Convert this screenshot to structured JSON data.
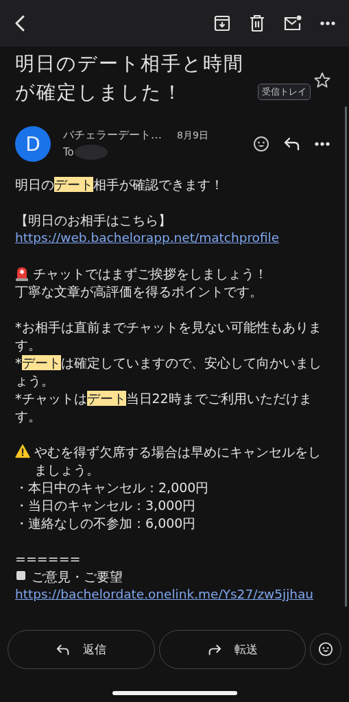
{
  "toolbar": {
    "actions": [
      {
        "kind": "archive"
      },
      {
        "kind": "delete"
      },
      {
        "kind": "unread"
      },
      {
        "kind": "more"
      }
    ]
  },
  "subject": {
    "title": "明日のデート相手と時間が確定しました！",
    "label": "受信トレイ",
    "starred": false
  },
  "message": {
    "avatar": "D",
    "sender": "バチェラーデート…",
    "date": "8月9日",
    "to": "To"
  },
  "body": [
    {
      "lines": [
        {
          "kind": "text",
          "segments": [
            {
              "text": "明日の",
              "highlighted": false
            },
            {
              "text": "デート",
              "highlighted": true
            },
            {
              "text": "相手が確認できます！",
              "highlighted": false
            }
          ]
        }
      ]
    },
    {
      "lines": [
        {
          "kind": "text",
          "segments": [
            {
              "text": "【明日のお相手はこちら】",
              "highlighted": false
            }
          ]
        },
        {
          "kind": "link",
          "segments": [
            {
              "text": "https://web.bachelorapp.net/matchprofile",
              "highlighted": false
            }
          ]
        }
      ]
    },
    {
      "lines": [
        {
          "kind": "siren",
          "segments": [
            {
              "text": "チャットではまずご挨拶をしましょう！",
              "highlighted": false
            }
          ]
        },
        {
          "kind": "text",
          "segments": [
            {
              "text": "丁寧な文章が高評価を得るポイントです。",
              "highlighted": false
            }
          ]
        }
      ]
    },
    {
      "lines": [
        {
          "kind": "text",
          "segments": [
            {
              "text": "*お相手は直前までチャットを見ない可能性もあります。",
              "highlighted": false
            }
          ]
        },
        {
          "kind": "text",
          "segments": [
            {
              "text": "*",
              "highlighted": false
            },
            {
              "text": "デート",
              "highlighted": true
            },
            {
              "text": "は確定していますので、安心して向かいましょう。",
              "highlighted": false
            }
          ]
        },
        {
          "kind": "text",
          "segments": [
            {
              "text": "*チャットは",
              "highlighted": false
            },
            {
              "text": "デート",
              "highlighted": true
            },
            {
              "text": "当日22時までご利用いただけます。",
              "highlighted": false
            }
          ]
        }
      ]
    },
    {
      "lines": [
        {
          "kind": "warning",
          "segments": [
            {
              "text": "やむを得ず欠席する場合は早めにキャンセルをしましょう。",
              "highlighted": false
            }
          ]
        },
        {
          "kind": "text",
          "segments": [
            {
              "text": "・本日中のキャンセル：2,000円",
              "highlighted": false
            }
          ]
        },
        {
          "kind": "text",
          "segments": [
            {
              "text": "・当日のキャンセル：3,000円",
              "highlighted": false
            }
          ]
        },
        {
          "kind": "text",
          "segments": [
            {
              "text": "・連絡なしの不参加：6,000円",
              "highlighted": false
            }
          ]
        }
      ]
    },
    {
      "lines": [
        {
          "kind": "text",
          "segments": [
            {
              "text": "======",
              "highlighted": false
            }
          ]
        },
        {
          "kind": "square",
          "segments": [
            {
              "text": "ご意見・ご要望",
              "highlighted": false
            }
          ]
        },
        {
          "kind": "link",
          "segments": [
            {
              "text": "https://bachelordate.onelink.me/Ys27/zw5jjhau",
              "highlighted": false
            }
          ]
        }
      ]
    }
  ],
  "footer": {
    "buttons": [
      {
        "kind": "reply",
        "label": "返信"
      },
      {
        "kind": "forward",
        "label": "転送"
      },
      {
        "kind": "emoji"
      }
    ]
  }
}
